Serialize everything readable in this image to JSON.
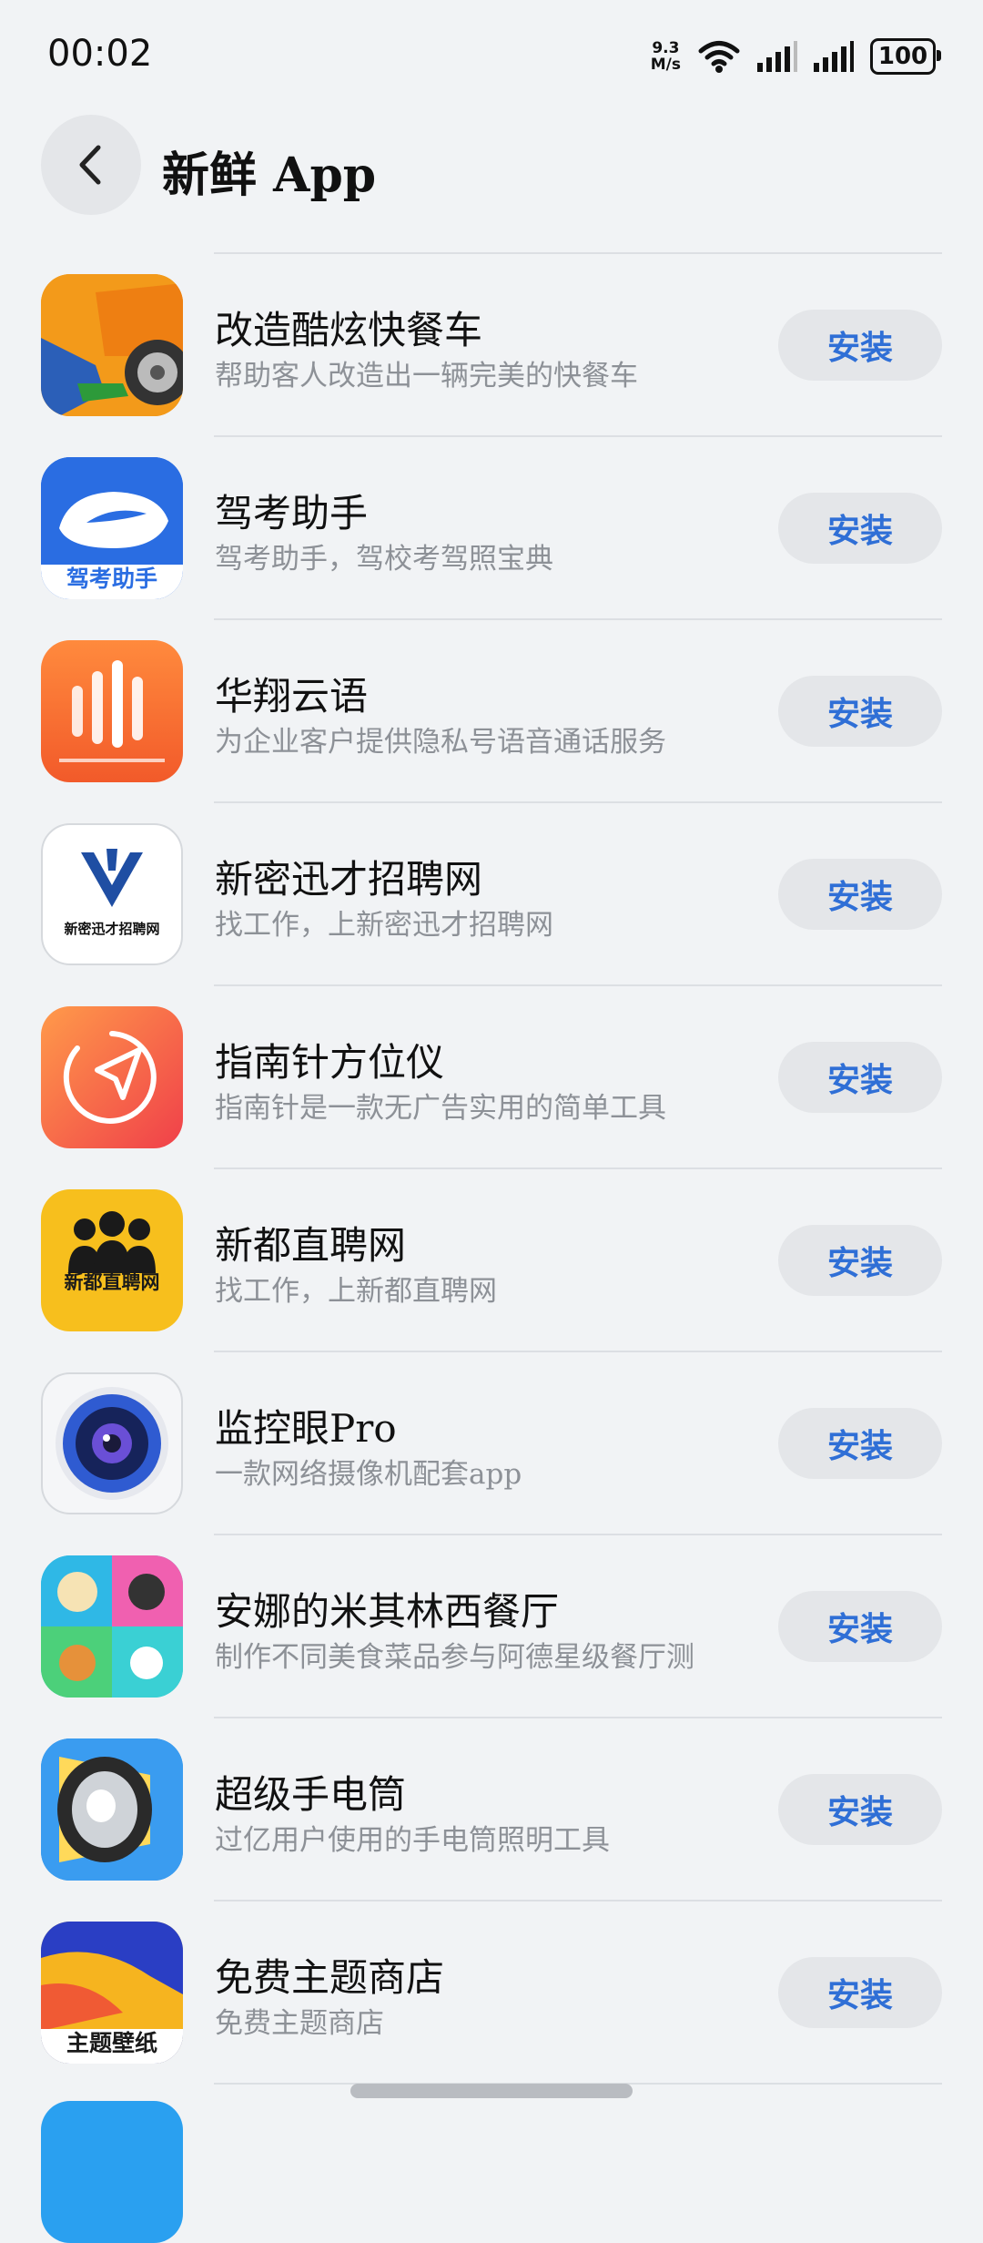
{
  "status_bar": {
    "time": "00:02",
    "net_speed_value": "9.3",
    "net_speed_unit": "M/s",
    "battery": "100"
  },
  "header": {
    "title": "新鲜 App",
    "back_icon": "chevron-left-icon"
  },
  "apps": [
    {
      "name": "改造酷炫快餐车",
      "desc": "帮助客人改造出一辆完美的快餐车",
      "button": "安装"
    },
    {
      "name": "驾考助手",
      "desc": "驾考助手，驾校考驾照宝典",
      "button": "安装",
      "icon_text": "驾考助手"
    },
    {
      "name": "华翔云语",
      "desc": "为企业客户提供隐私号语音通话服务",
      "button": "安装"
    },
    {
      "name": "新密迅才招聘网",
      "desc": "找工作，上新密迅才招聘网",
      "button": "安装",
      "icon_text": "新密迅才招聘网"
    },
    {
      "name": "指南针方位仪",
      "desc": "指南针是一款无广告实用的简单工具",
      "button": "安装"
    },
    {
      "name": "新都直聘网",
      "desc": "找工作，上新都直聘网",
      "button": "安装",
      "icon_text": "新都直聘网"
    },
    {
      "name": "监控眼Pro",
      "desc": "一款网络摄像机配套app",
      "button": "安装"
    },
    {
      "name": "安娜的米其林西餐厅",
      "desc": "制作不同美食菜品参与阿德星级餐厅测",
      "button": "安装"
    },
    {
      "name": "超级手电筒",
      "desc": "过亿用户使用的手电筒照明工具",
      "button": "安装"
    },
    {
      "name": "免费主题商店",
      "desc": "免费主题商店",
      "button": "安装",
      "icon_text": "主题壁纸"
    }
  ]
}
